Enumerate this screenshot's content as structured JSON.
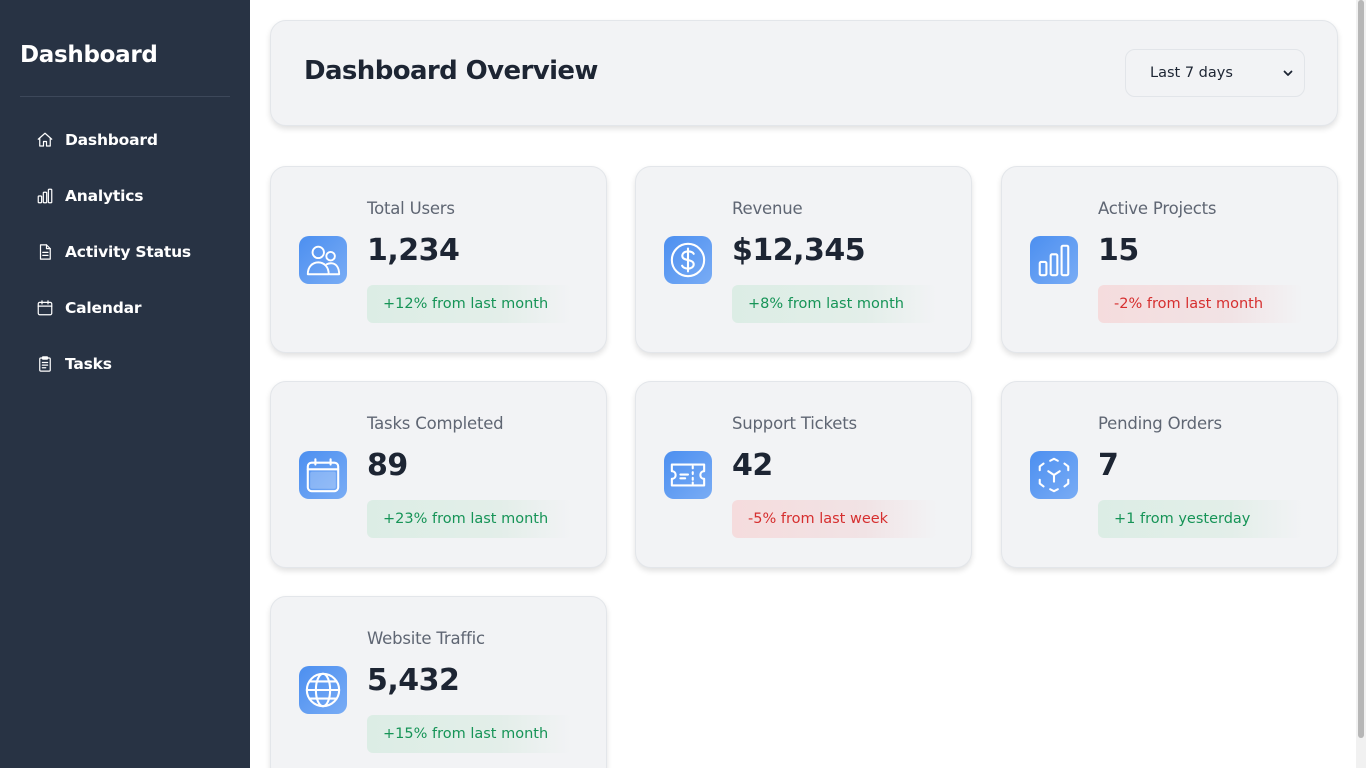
{
  "sidebar": {
    "brand": "Dashboard",
    "items": [
      {
        "label": "Dashboard",
        "icon": "home-icon"
      },
      {
        "label": "Analytics",
        "icon": "bar-chart-icon"
      },
      {
        "label": "Activity Status",
        "icon": "document-icon"
      },
      {
        "label": "Calendar",
        "icon": "calendar-icon"
      },
      {
        "label": "Tasks",
        "icon": "clipboard-icon"
      }
    ]
  },
  "header": {
    "title": "Dashboard Overview",
    "period_select": {
      "value": "Last 7 days"
    }
  },
  "cards": [
    {
      "label": "Total Users",
      "value": "1,234",
      "trend": "+12% from last month",
      "trend_direction": "up",
      "icon": "users-icon"
    },
    {
      "label": "Revenue",
      "value": "$12,345",
      "trend": "+8% from last month",
      "trend_direction": "up",
      "icon": "dollar-icon"
    },
    {
      "label": "Active Projects",
      "value": "15",
      "trend": "-2% from last month",
      "trend_direction": "down",
      "icon": "bar-chart-icon"
    },
    {
      "label": "Tasks Completed",
      "value": "89",
      "trend": "+23% from last month",
      "trend_direction": "up",
      "icon": "calendar-icon"
    },
    {
      "label": "Support Tickets",
      "value": "42",
      "trend": "-5% from last week",
      "trend_direction": "down",
      "icon": "ticket-icon"
    },
    {
      "label": "Pending Orders",
      "value": "7",
      "trend": "+1 from yesterday",
      "trend_direction": "up",
      "icon": "package-scan-icon"
    },
    {
      "label": "Website Traffic",
      "value": "5,432",
      "trend": "+15% from last month",
      "trend_direction": "up",
      "icon": "globe-icon"
    }
  ],
  "colors": {
    "sidebar_bg": "#283344",
    "card_bg": "#f2f3f5",
    "text_primary": "#1d2533",
    "text_secondary": "#5f6673",
    "trend_up": "#169457",
    "trend_down": "#d62f2f",
    "icon_gradient_start": "#4c8ff0",
    "icon_gradient_end": "#79acf5"
  }
}
